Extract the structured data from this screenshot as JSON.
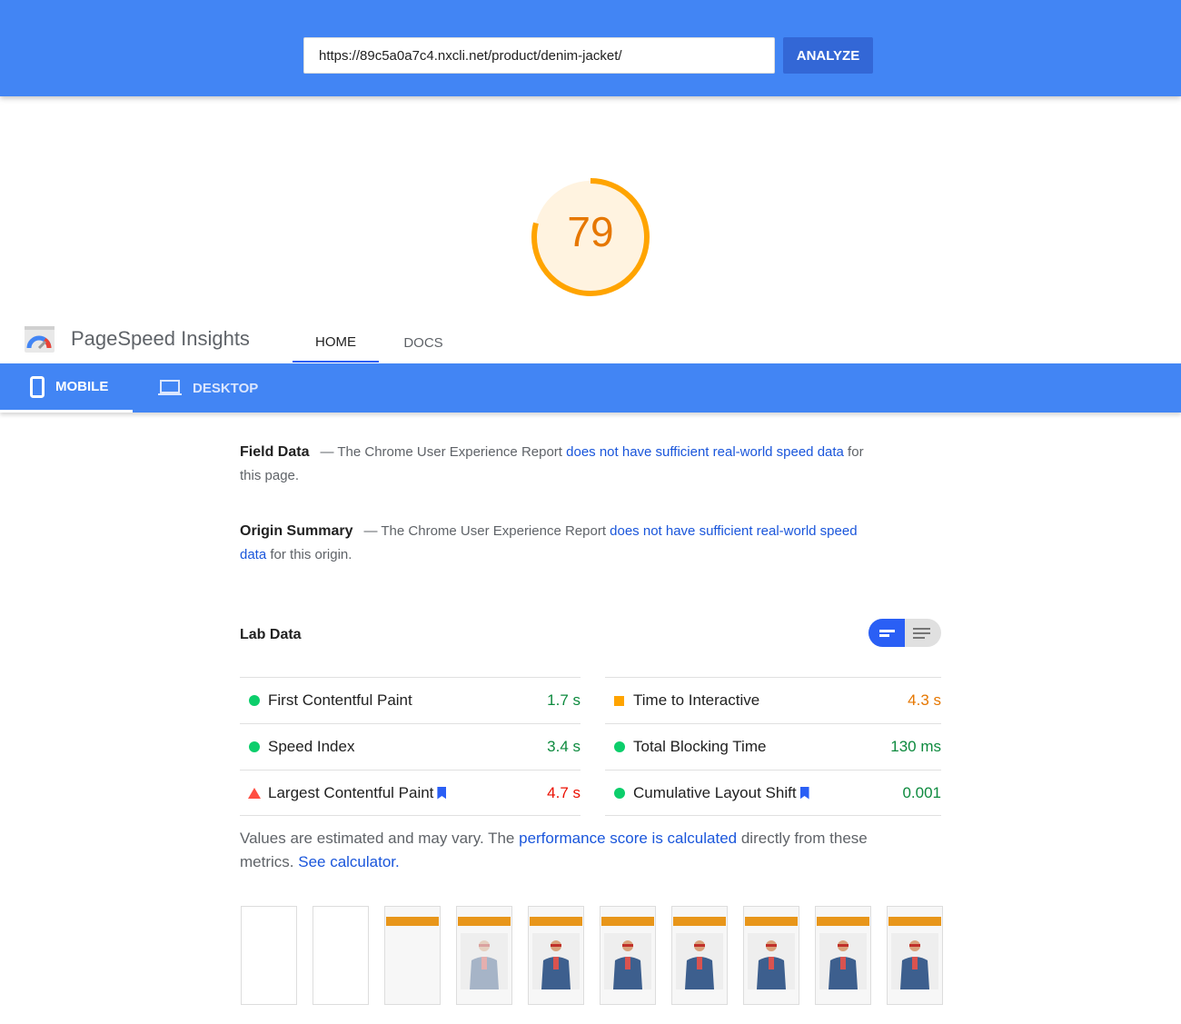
{
  "search": {
    "url": "https://89c5a0a7c4.nxcli.net/product/denim-jacket/",
    "analyze_label": "ANALYZE"
  },
  "score": {
    "value": 79,
    "color": "#ffa400"
  },
  "header": {
    "title": "PageSpeed Insights",
    "tabs": [
      {
        "label": "HOME",
        "active": true
      },
      {
        "label": "DOCS",
        "active": false
      }
    ]
  },
  "device_tabs": [
    {
      "label": "MOBILE",
      "icon": "smartphone-icon",
      "active": true
    },
    {
      "label": "DESKTOP",
      "icon": "laptop-icon",
      "active": false
    }
  ],
  "field_data": {
    "heading": "Field Data",
    "pre": "— The Chrome User Experience Report ",
    "link": "does not have sufficient real-world speed data",
    "post": " for this page."
  },
  "origin_summary": {
    "heading": "Origin Summary",
    "pre": "— The Chrome User Experience Report ",
    "link": "does not have sufficient real-world speed data",
    "post": " for this origin."
  },
  "lab_data": {
    "heading": "Lab Data",
    "left": [
      {
        "name": "First Contentful Paint",
        "value": "1.7 s",
        "status": "pass"
      },
      {
        "name": "Speed Index",
        "value": "3.4 s",
        "status": "pass"
      },
      {
        "name": "Largest Contentful Paint",
        "value": "4.7 s",
        "status": "fail",
        "bookmark": true
      }
    ],
    "right": [
      {
        "name": "Time to Interactive",
        "value": "4.3 s",
        "status": "average"
      },
      {
        "name": "Total Blocking Time",
        "value": "130 ms",
        "status": "pass"
      },
      {
        "name": "Cumulative Layout Shift",
        "value": "0.001",
        "status": "pass",
        "bookmark": true
      }
    ]
  },
  "note": {
    "pre": "Values are estimated and may vary. The ",
    "link1": "performance score is calculated",
    "mid": " directly from these metrics. ",
    "link2": "See calculator."
  },
  "colors": {
    "pass": "#0d8a3e",
    "average": "#e67700",
    "fail": "#eb0f00",
    "brand": "#4285f4"
  },
  "filmstrip": [
    "blank",
    "blank",
    "page-no-image",
    "page-faded-image",
    "page-image",
    "page-image",
    "page-image",
    "page-image",
    "page-image",
    "page-image"
  ]
}
